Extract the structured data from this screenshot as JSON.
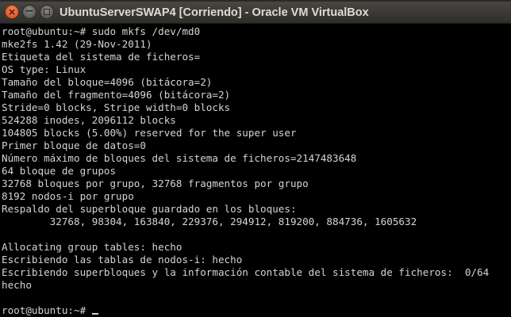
{
  "window": {
    "title": "UbuntuServerSWAP4 [Corriendo] - Oracle VM VirtualBox",
    "close_glyph": "×",
    "minimize_glyph": "−"
  },
  "terminal": {
    "lines": [
      "root@ubuntu:~# sudo mkfs /dev/md0",
      "mke2fs 1.42 (29-Nov-2011)",
      "Etiqueta del sistema de ficheros=",
      "OS type: Linux",
      "Tamaño del bloque=4096 (bitácora=2)",
      "Tamaño del fragmento=4096 (bitácora=2)",
      "Stride=0 blocks, Stripe width=0 blocks",
      "524288 inodes, 2096112 blocks",
      "104805 blocks (5.00%) reserved for the super user",
      "Primer bloque de datos=0",
      "Número máximo de bloques del sistema de ficheros=2147483648",
      "64 bloque de grupos",
      "32768 bloques por grupo, 32768 fragmentos por grupo",
      "8192 nodos-i por grupo",
      "Respaldo del superbloque guardado en los bloques:",
      "        32768, 98304, 163840, 229376, 294912, 819200, 884736, 1605632",
      "",
      "Allocating group tables: hecho",
      "Escribiendo las tablas de nodos-i: hecho",
      "Escribiendo superbloques y la información contable del sistema de ficheros:  0/64",
      "hecho",
      "",
      "root@ubuntu:~# "
    ]
  }
}
